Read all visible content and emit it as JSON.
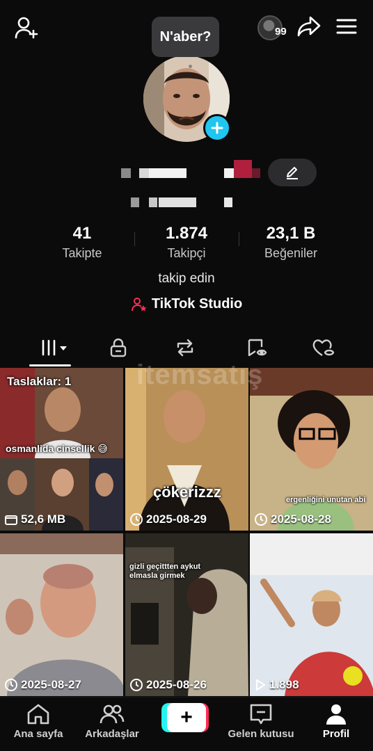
{
  "header": {
    "add_user_icon": "person-add-icon",
    "story_count": "99",
    "share_icon": "share-icon",
    "menu_icon": "hamburger-menu-icon"
  },
  "bubble": {
    "text": "N'aber?"
  },
  "stats": {
    "following": {
      "value": "41",
      "label": "Takipte"
    },
    "followers": {
      "value": "1.874",
      "label": "Takipçi"
    },
    "likes": {
      "value": "23,1 B",
      "label": "Beğeniler"
    }
  },
  "bio": "takip edin",
  "studio": {
    "label": "TikTok Studio"
  },
  "tabs": [
    "videos-grid-icon",
    "lock-icon",
    "repost-icon",
    "favorites-icon",
    "liked-icon"
  ],
  "grid": {
    "watermark": "itemsatış",
    "items": [
      {
        "top_label": "Taslaklar: 1",
        "caption": "osmanlida cinsellik 😅",
        "meta": "52,6 MB",
        "meta_icon": "folder-icon"
      },
      {
        "caption": "çökerizzz",
        "meta": "2025-08-29",
        "meta_icon": "clock-icon"
      },
      {
        "caption": "ergenliğini unutan abi",
        "meta": "2025-08-28",
        "meta_icon": "clock-icon"
      },
      {
        "caption": "",
        "meta": "2025-08-27",
        "meta_icon": "clock-icon"
      },
      {
        "caption": "gizli geçittten aykut elmasla girmek",
        "meta": "2025-08-26",
        "meta_icon": "clock-icon"
      },
      {
        "caption": "",
        "meta": "1.898",
        "meta_icon": "play-icon"
      }
    ]
  },
  "nav": {
    "home": "Ana sayfa",
    "friends": "Arkadaşlar",
    "create": "+",
    "inbox": "Gelen kutusu",
    "profile": "Profil"
  },
  "colors": {
    "background": "#0b0b0b",
    "accent_blue": "#20c5f0",
    "tiktok_red": "#ff2c55",
    "tiktok_cyan": "#25f4ee"
  }
}
